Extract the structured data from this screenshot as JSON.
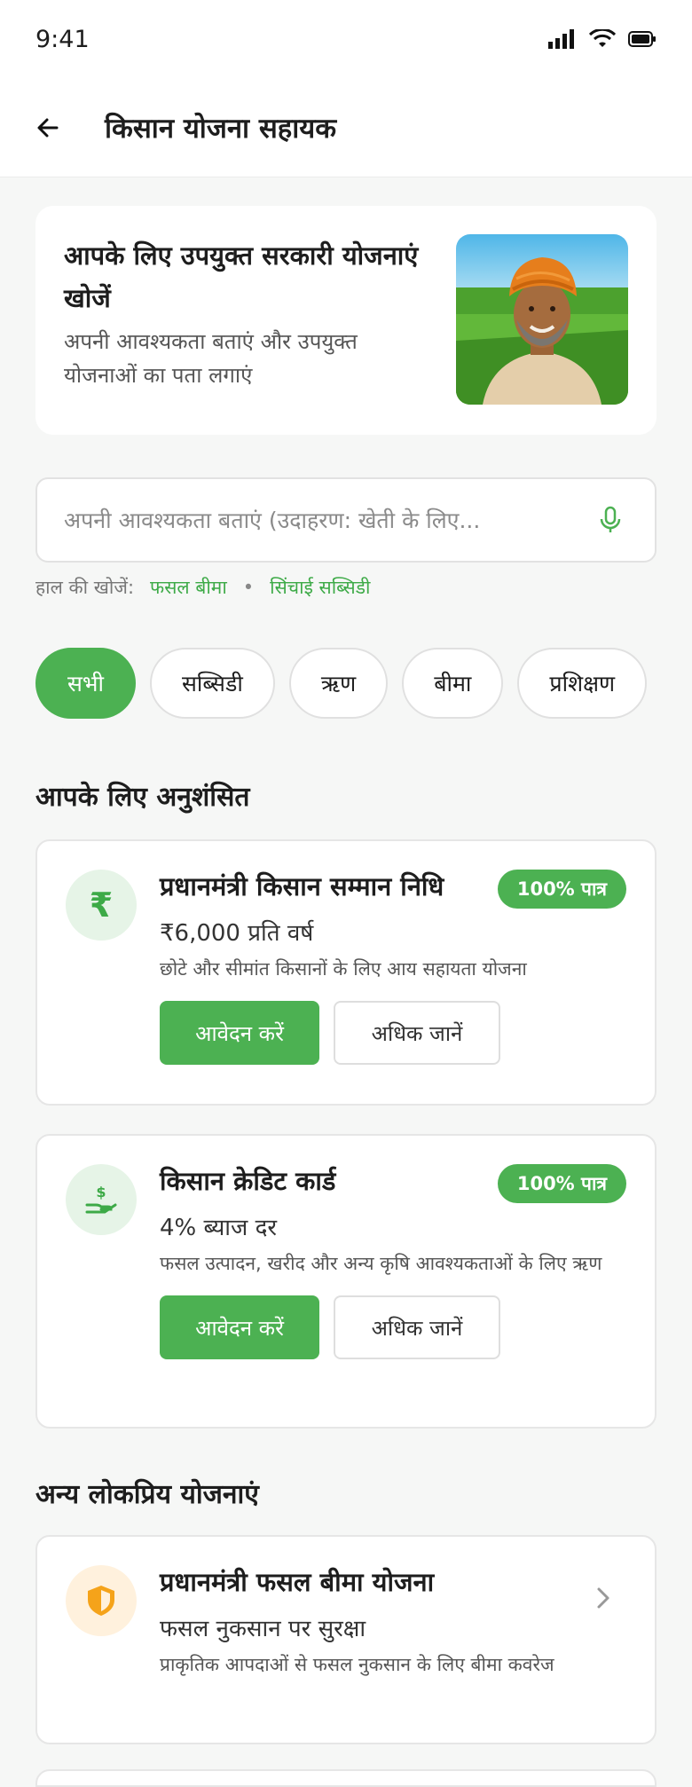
{
  "status": {
    "time": "9:41"
  },
  "header": {
    "title": "किसान योजना सहायक"
  },
  "hero": {
    "title": "आपके लिए उपयुक्त सरकारी योजनाएं खोजें",
    "subtitle": "अपनी आवश्यकता बताएं और उपयुक्त योजनाओं का पता लगाएं"
  },
  "search": {
    "placeholder": "अपनी आवश्यकता बताएं (उदाहरण: खेती के लिए..."
  },
  "recent": {
    "label": "हाल की खोजें:",
    "items": [
      "फसल बीमा",
      "सिंचाई सब्सिडी"
    ]
  },
  "chips": [
    "सभी",
    "सब्सिडी",
    "ऋण",
    "बीमा",
    "प्रशिक्षण"
  ],
  "sections": {
    "recommended": "आपके लिए अनुशंसित",
    "popular": "अन्य लोकप्रिय योजनाएं"
  },
  "recommended": [
    {
      "name": "प्रधानमंत्री किसान सम्मान निधि",
      "value": "₹6,000 प्रति वर्ष",
      "desc": "छोटे और सीमांत किसानों के लिए आय सहायता योजना",
      "badge": "100% पात्र",
      "apply": "आवेदन करें",
      "more": "अधिक जानें",
      "icon_glyph": "₹"
    },
    {
      "name": "किसान क्रेडिट कार्ड",
      "value": "4% ब्याज दर",
      "desc": "फसल उत्पादन, खरीद और अन्य कृषि आवश्यकताओं के लिए ऋण",
      "badge": "100% पात्र",
      "apply": "आवेदन करें",
      "more": "अधिक जानें"
    }
  ],
  "popular": [
    {
      "name": "प्रधानमंत्री फसल बीमा योजना",
      "value": "फसल नुकसान पर सुरक्षा",
      "desc": "प्राकृतिक आपदाओं से फसल नुकसान के लिए बीमा कवरेज"
    }
  ],
  "colors": {
    "accent": "#4cb152",
    "icon_green_bg": "#e6f4e7",
    "icon_orange_bg": "#fff1dd",
    "icon_orange": "#f5a31a"
  }
}
